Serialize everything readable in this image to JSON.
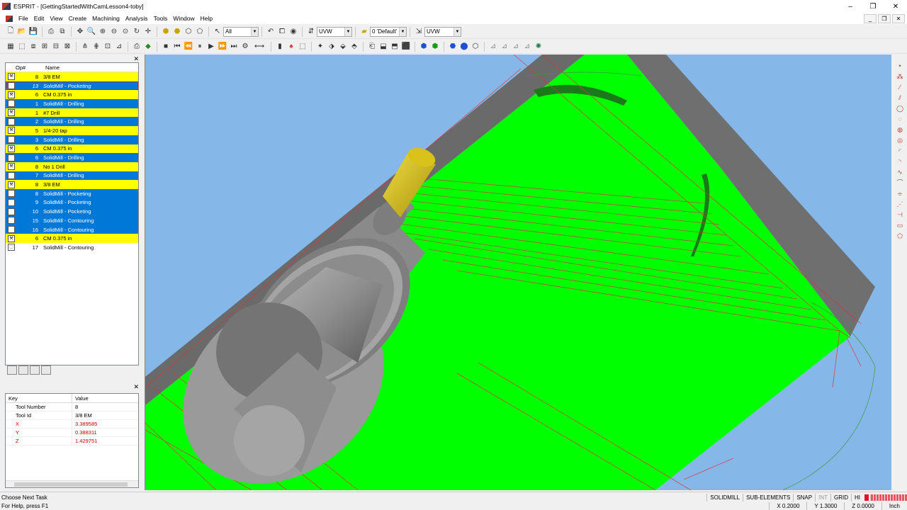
{
  "window": {
    "app": "ESPRIT",
    "title": "ESPRIT - [GettingStartedWithCamLesson4-toby]"
  },
  "menu": [
    "File",
    "Edit",
    "View",
    "Create",
    "Machining",
    "Analysis",
    "Tools",
    "Window",
    "Help"
  ],
  "toolbar": {
    "filter_combo": "All",
    "workplane_combo1": "UVW",
    "layer_combo": "0 'Default'",
    "workplane_combo2": "UVW"
  },
  "operations": {
    "headers": {
      "op": "Op#",
      "name": "Name"
    },
    "rows": [
      {
        "num": "8",
        "name": "3/8 EM",
        "style": "yellow",
        "icon": "tool"
      },
      {
        "num": "13",
        "name": "SolidMill - Pocketing",
        "style": "sel",
        "icon": "pocket"
      },
      {
        "num": "6",
        "name": "CM 0.375 in",
        "style": "yellow",
        "icon": "tool"
      },
      {
        "num": "1",
        "name": "SolidMill - Drilling",
        "style": "blue",
        "icon": "drill"
      },
      {
        "num": "1",
        "name": "#7 Drill",
        "style": "yellow",
        "icon": "tool"
      },
      {
        "num": "2",
        "name": "SolidMill - Drilling",
        "style": "blue",
        "icon": "drill"
      },
      {
        "num": "5",
        "name": "1/4-20 tap",
        "style": "yellow",
        "icon": "tool"
      },
      {
        "num": "3",
        "name": "SolidMill - Drilling",
        "style": "blue",
        "icon": "drill"
      },
      {
        "num": "6",
        "name": "CM 0.375 in",
        "style": "yellow",
        "icon": "tool"
      },
      {
        "num": "6",
        "name": "SolidMill - Drilling",
        "style": "blue",
        "icon": "drill"
      },
      {
        "num": "8",
        "name": "No 1 Drill",
        "style": "yellow",
        "icon": "tool"
      },
      {
        "num": "7",
        "name": "SolidMill - Drilling",
        "style": "blue",
        "icon": "drill"
      },
      {
        "num": "8",
        "name": "3/8 EM",
        "style": "yellow",
        "icon": "tool"
      },
      {
        "num": "8",
        "name": "SolidMill - Pocketing",
        "style": "blue",
        "icon": "pocket"
      },
      {
        "num": "9",
        "name": "SolidMill - Pocketing",
        "style": "blue",
        "icon": "pocket"
      },
      {
        "num": "10",
        "name": "SolidMill - Pocketing",
        "style": "blue",
        "icon": "pocket"
      },
      {
        "num": "15",
        "name": "SolidMill - Contouring",
        "style": "blue",
        "icon": "contour"
      },
      {
        "num": "16",
        "name": "SolidMill - Contouring",
        "style": "blue",
        "icon": "contour"
      },
      {
        "num": "6",
        "name": "CM 0.375 in",
        "style": "yellow",
        "icon": "tool"
      },
      {
        "num": "17",
        "name": "SolidMill - Contouring",
        "style": "white",
        "icon": "contour"
      }
    ]
  },
  "properties": {
    "headers": {
      "key": "Key",
      "value": "Value"
    },
    "rows": [
      {
        "key": "Tool Number",
        "value": "8",
        "red": false
      },
      {
        "key": "Tool Id",
        "value": "3/8 EM",
        "red": false
      },
      {
        "key": "X",
        "value": "3.389585",
        "red": true
      },
      {
        "key": "Y",
        "value": "0.388311",
        "red": true
      },
      {
        "key": "Z",
        "value": "1.429751",
        "red": true
      }
    ]
  },
  "status": {
    "task": "Choose Next Task",
    "help": "For Help, press F1",
    "flags": [
      "SOLIDMILL",
      "SUB-ELEMENTS",
      "SNAP",
      "INT",
      "GRID",
      "HI"
    ],
    "coords": {
      "x": "X 0.2000",
      "y": "Y 1.3000",
      "z": "Z 0.0000",
      "unit": "Inch"
    }
  },
  "colors": {
    "viewport_bg": "#85b8e8",
    "stock_top": "#00ff00",
    "stock_side": "#6e6e6e",
    "toolpath": "#e0323a",
    "tool_holder": "#9a9a9a",
    "cutter": "#d9c21a",
    "op_tool_row": "#ffff00",
    "op_selected_row": "#0078d7"
  }
}
